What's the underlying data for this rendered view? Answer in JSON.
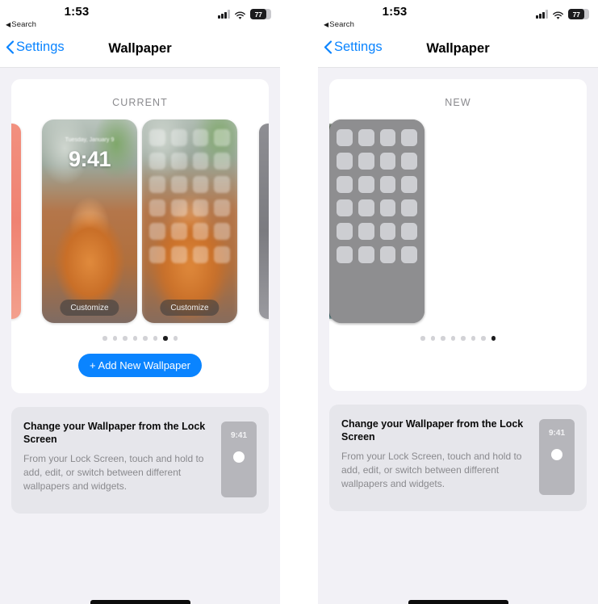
{
  "status_bar": {
    "back_label": "Search",
    "back_icon": "left-triangle-icon",
    "time": "1:53",
    "signal_icon": "cellular-signal-icon",
    "wifi_icon": "wifi-icon",
    "battery_icon": "battery-icon",
    "battery_percent": "77"
  },
  "nav": {
    "back_label": "Settings",
    "back_icon": "chevron-left-icon",
    "title": "Wallpaper"
  },
  "left_panel": {
    "section_label": "CURRENT",
    "lock_preview": {
      "date": "Tuesday, January 9",
      "time": "9:41",
      "customize_label": "Customize"
    },
    "home_preview": {
      "customize_label": "Customize",
      "grid_rows": 6,
      "grid_cols": 4
    },
    "pager": {
      "total": 8,
      "active_index": 7
    },
    "add_button": {
      "label": "+ Add New Wallpaper",
      "color": "#0a84ff"
    }
  },
  "right_panel": {
    "section_label": "NEW",
    "add_new_icon": "plus-circle-icon",
    "home_preview": {
      "grid_rows": 6,
      "grid_cols": 4
    },
    "pager": {
      "total": 8,
      "active_index": 8
    }
  },
  "info_card": {
    "title": "Change your Wallpaper from the Lock Screen",
    "body": "From your Lock Screen, touch and hold to add, edit, or switch between different wallpapers and widgets.",
    "mini_phone_time": "9:41"
  },
  "colors": {
    "accent": "#0a84ff",
    "page_background": "#f2f1f6",
    "card_background": "#ffffff",
    "info_card_background": "#e6e6eb",
    "label_gray": "#8a8a8e"
  }
}
